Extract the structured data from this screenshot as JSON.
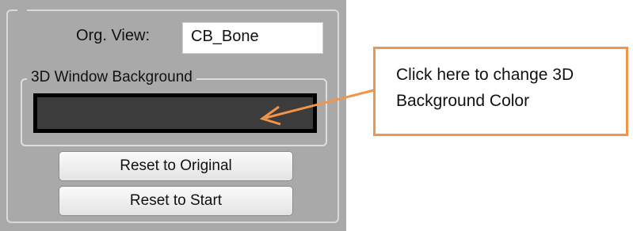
{
  "panel": {
    "org_view_label": "Org. View:",
    "org_view_value": "CB_Bone",
    "background_group_label": "3D Window Background",
    "background_color": "#3c3c3c",
    "reset_original_label": "Reset to Original",
    "reset_start_label": "Reset to Start"
  },
  "callout": {
    "text": "Click here to change 3D Background Color",
    "border_color": "#f0954a"
  }
}
